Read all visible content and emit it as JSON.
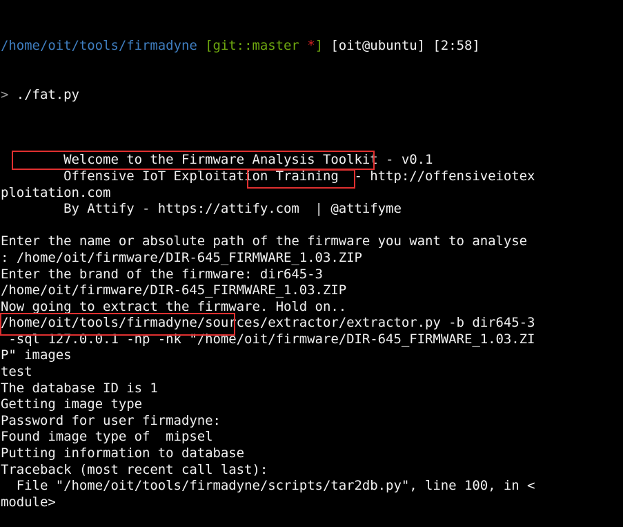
{
  "prompt": {
    "path": "/home/oit/tools/firmadyne",
    "git_open": "[git::master ",
    "git_star": "*",
    "git_close": "]",
    "user_host": " [oit@ubuntu] [2:58]",
    "symbol": ">",
    "command": " ./fat.py"
  },
  "output_lines": [
    "",
    "        Welcome to the Firmware Analysis Toolkit - v0.1",
    "        Offensive IoT Exploitation Training  - http://offensiveiotex",
    "ploitation.com",
    "        By Attify - https://attify.com  | @attifyme",
    "",
    "Enter the name or absolute path of the firmware you want to analyse",
    ": /home/oit/firmware/DIR-645_FIRMWARE_1.03.ZIP",
    "Enter the brand of the firmware: dir645-3",
    "/home/oit/firmware/DIR-645_FIRMWARE_1.03.ZIP",
    "Now going to extract the firmware. Hold on..",
    "/home/oit/tools/firmadyne/sources/extractor/extractor.py -b dir645-3",
    " -sql 127.0.0.1 -np -nk \"/home/oit/firmware/DIR-645_FIRMWARE_1.03.ZI",
    "P\" images",
    "test",
    "The database ID is 1",
    "Getting image type",
    "Password for user firmadyne:",
    "Found image type of  mipsel",
    "Putting information to database",
    "Traceback (most recent call last):",
    "  File \"/home/oit/tools/firmadyne/scripts/tar2db.py\", line 100, in <",
    "module>"
  ]
}
